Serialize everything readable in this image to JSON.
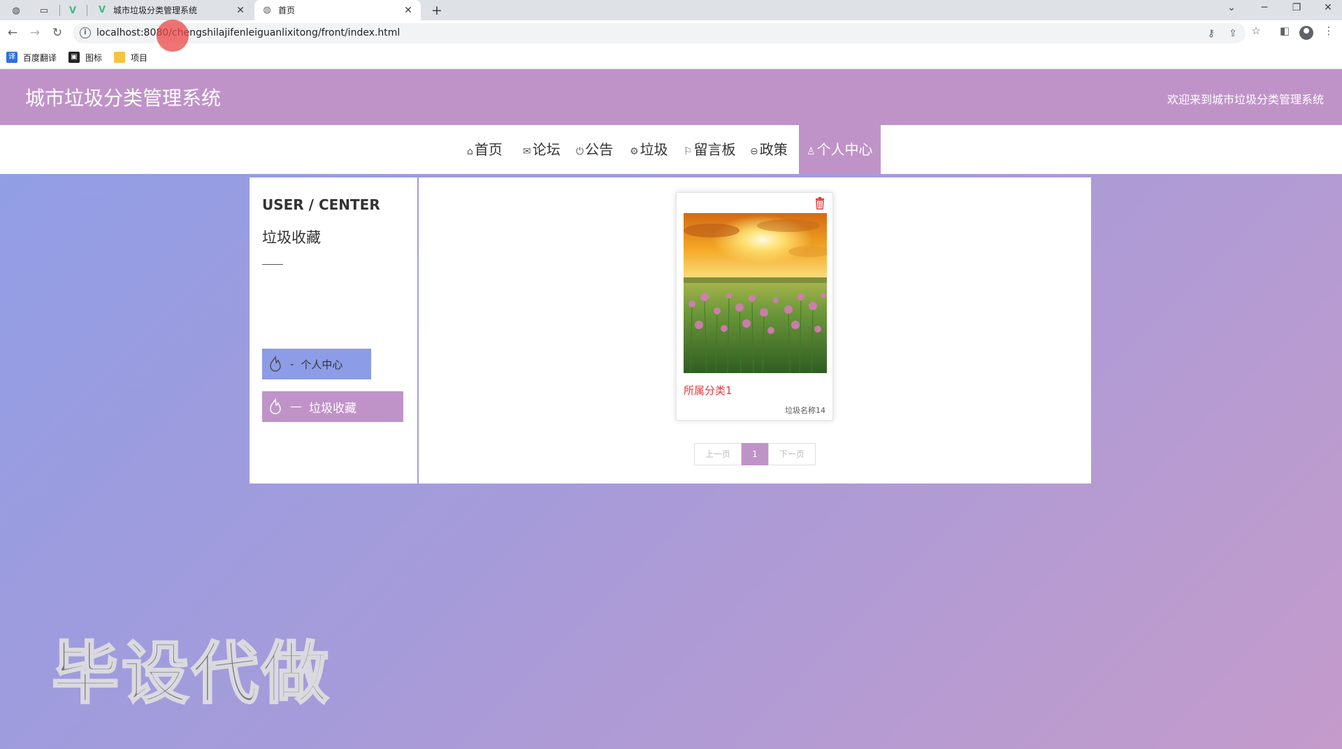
{
  "browser": {
    "tabs": [
      {
        "title": "城市垃圾分类管理系统",
        "close": "✕"
      },
      {
        "title": "首页",
        "close": "✕"
      }
    ],
    "new_tab": "+",
    "url": "localhost:8080/chengshilajifenleiguanlixitong/front/index.html",
    "bookmarks": [
      "百度翻译",
      "图标",
      "项目"
    ],
    "controls": {
      "minimize": "─",
      "restore": "❐",
      "close": "✕",
      "dropdown": "⌄"
    }
  },
  "site": {
    "title": "城市垃圾分类管理系统",
    "welcome": "欢迎来到城市垃圾分类管理系统",
    "nav": [
      {
        "icon": "⌂",
        "label": "首页"
      },
      {
        "icon": "✉",
        "label": "论坛"
      },
      {
        "icon": "⏻",
        "label": "公告"
      },
      {
        "icon": "⚙",
        "label": "垃圾"
      },
      {
        "icon": "⚐",
        "label": "留言板"
      },
      {
        "icon": "⊖",
        "label": "政策"
      },
      {
        "icon": "♙",
        "label": "个人中心"
      }
    ],
    "active_nav": "个人中心"
  },
  "side": {
    "heading": "USER / CENTER",
    "subheading": "垃圾收藏",
    "items": [
      {
        "dash": "-",
        "label": "个人中心"
      },
      {
        "dash": "—",
        "label": "垃圾收藏"
      }
    ]
  },
  "collection": {
    "cards": [
      {
        "category": "所属分类1",
        "name": "垃圾名称14"
      }
    ],
    "pager": {
      "prev": "上一页",
      "current": "1",
      "next": "下一页"
    }
  },
  "watermark": "毕设代做",
  "colors": {
    "header": "#c093c8",
    "side_item_blue": "#8c9ce6",
    "category_red": "#e4393c"
  }
}
